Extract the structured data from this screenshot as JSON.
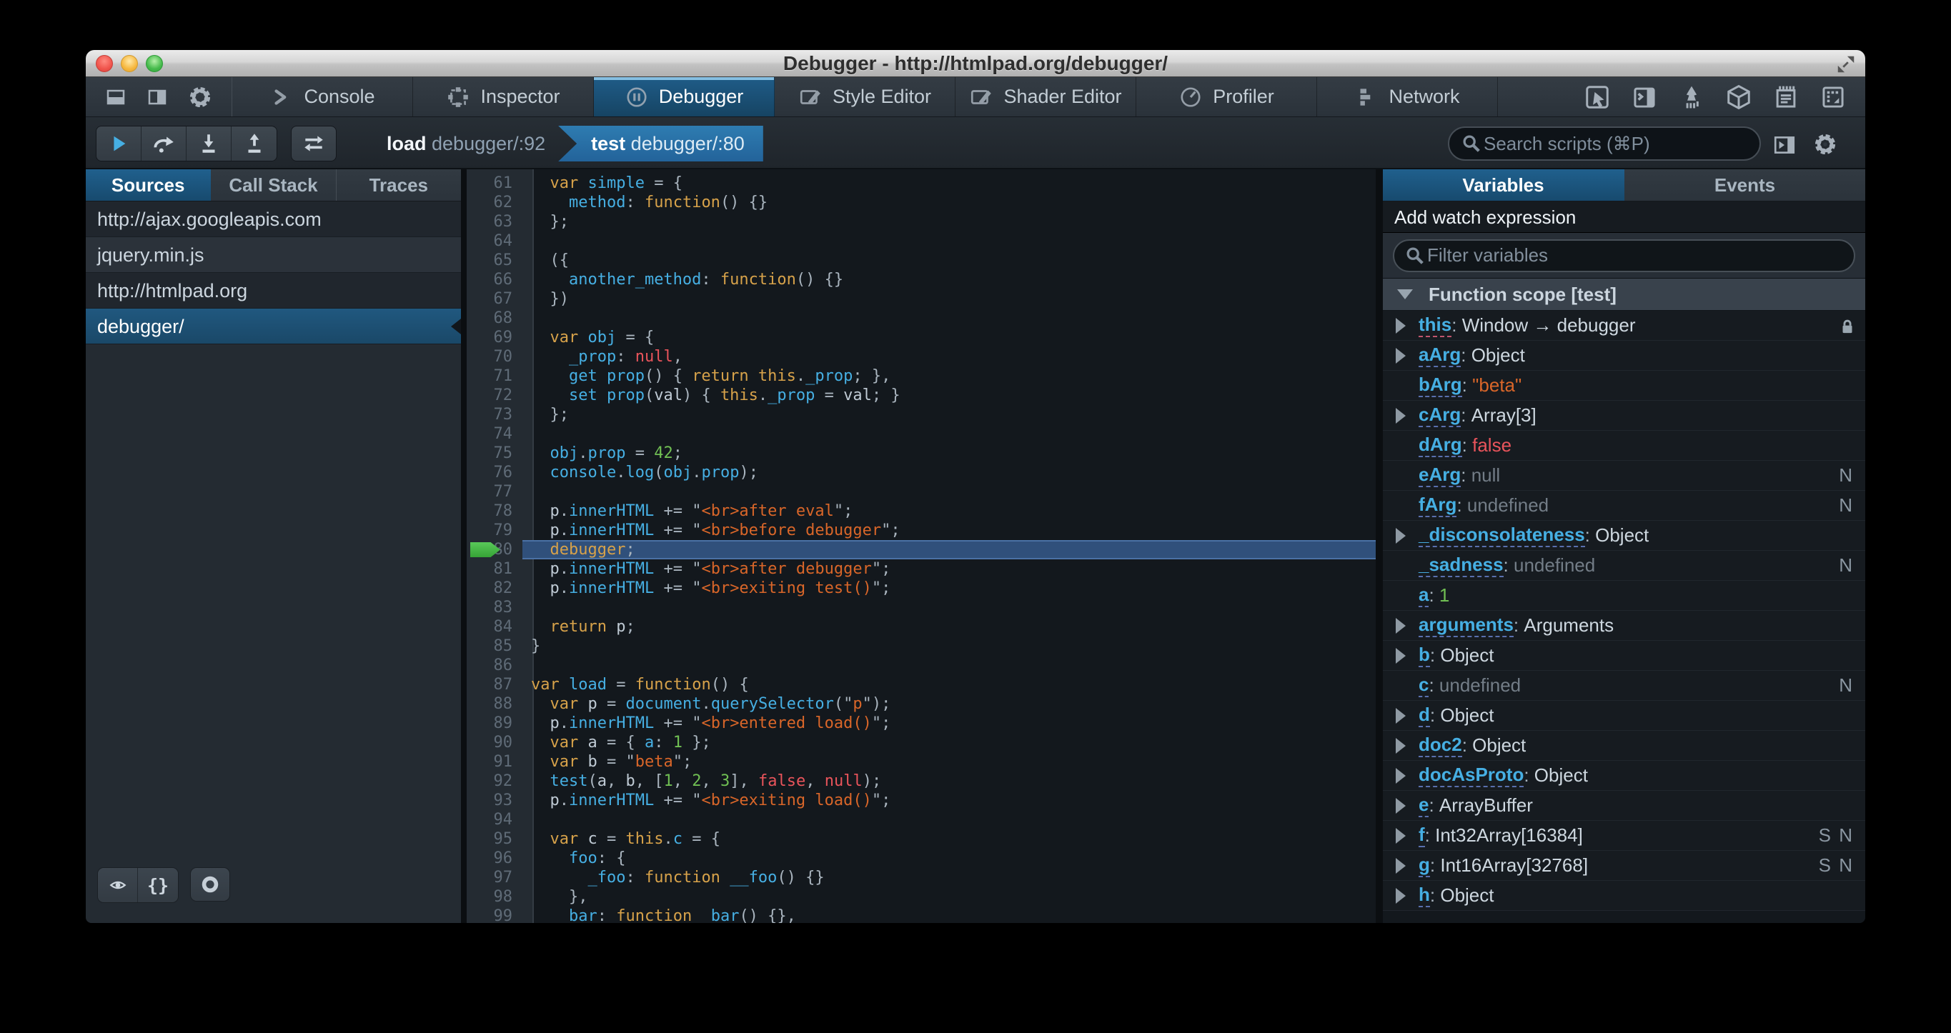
{
  "window": {
    "title": "Debugger - http://htmlpad.org/debugger/"
  },
  "colors": {
    "accent_blue": "#46afe3",
    "tab_active": "#1f5c88",
    "selection_blue": "#20587f",
    "breadcrumb_active": "#2a71a8",
    "current_line": "#30507b",
    "run_arrow_green": "#46bb46",
    "keyword": "#d7a24a",
    "string": "#d96629",
    "number": "#70bf53",
    "atom_red": "#e9545b",
    "toolbar_bg": "#2e363e",
    "editor_bg": "#13181d"
  },
  "toolbar": {
    "left_icons": [
      "dock-bottom",
      "dock-side",
      "settings-gear"
    ],
    "tabs": [
      {
        "label": "Console",
        "icon": "console"
      },
      {
        "label": "Inspector",
        "icon": "inspector"
      },
      {
        "label": "Debugger",
        "icon": "debugger"
      },
      {
        "label": "Style Editor",
        "icon": "style-editor"
      },
      {
        "label": "Shader Editor",
        "icon": "shader-editor"
      },
      {
        "label": "Profiler",
        "icon": "profiler"
      },
      {
        "label": "Network",
        "icon": "network"
      }
    ],
    "active_tab": "Debugger",
    "right_icons": [
      "pick-element",
      "split-console",
      "paintbrush",
      "tilt-3d",
      "scratchpad",
      "responsive-mode"
    ]
  },
  "debugger_toolbar": {
    "buttons": [
      "resume",
      "step-over",
      "step-in",
      "step-out"
    ],
    "toggle_button": "toggle-breakpoints",
    "breadcrumbs": [
      {
        "fn": "load",
        "loc": " debugger/:92",
        "active": false
      },
      {
        "fn": "test",
        "loc": " debugger/:80",
        "active": true
      }
    ],
    "search_placeholder": "Search scripts (⌘P)"
  },
  "sources_panel": {
    "tabs": [
      "Sources",
      "Call Stack",
      "Traces"
    ],
    "active_tab": "Sources",
    "items": [
      {
        "label": "http://ajax.googleapis.com",
        "type": "domain",
        "selected": false
      },
      {
        "label": "jquery.min.js",
        "type": "file",
        "selected": false
      },
      {
        "label": "http://htmlpad.org",
        "type": "domain",
        "selected": false
      },
      {
        "label": "debugger/",
        "type": "file",
        "selected": true
      }
    ],
    "bottom_buttons": [
      "blackbox-eye",
      "pretty-print",
      "pause-exceptions"
    ]
  },
  "editor": {
    "current_line": 80,
    "lines": [
      {
        "n": 61,
        "segs": [
          [
            "p",
            "  "
          ],
          [
            "k",
            "var"
          ],
          [
            "p",
            " "
          ],
          [
            "i",
            "simple"
          ],
          [
            "p",
            " = {"
          ]
        ]
      },
      {
        "n": 62,
        "segs": [
          [
            "p",
            "    "
          ],
          [
            "i",
            "method"
          ],
          [
            "p",
            ": "
          ],
          [
            "k",
            "function"
          ],
          [
            "p",
            "() {}"
          ]
        ]
      },
      {
        "n": 63,
        "segs": [
          [
            "p",
            "  };"
          ]
        ]
      },
      {
        "n": 64,
        "segs": []
      },
      {
        "n": 65,
        "segs": [
          [
            "p",
            "  ({"
          ]
        ]
      },
      {
        "n": 66,
        "segs": [
          [
            "p",
            "    "
          ],
          [
            "i",
            "another_method"
          ],
          [
            "p",
            ": "
          ],
          [
            "k",
            "function"
          ],
          [
            "p",
            "() {}"
          ]
        ]
      },
      {
        "n": 67,
        "segs": [
          [
            "p",
            "  })"
          ]
        ]
      },
      {
        "n": 68,
        "segs": []
      },
      {
        "n": 69,
        "segs": [
          [
            "p",
            "  "
          ],
          [
            "k",
            "var"
          ],
          [
            "p",
            " "
          ],
          [
            "i",
            "obj"
          ],
          [
            "p",
            " = {"
          ]
        ]
      },
      {
        "n": 70,
        "segs": [
          [
            "p",
            "    "
          ],
          [
            "i",
            "_prop"
          ],
          [
            "p",
            ": "
          ],
          [
            "a",
            "null"
          ],
          [
            "p",
            ","
          ]
        ]
      },
      {
        "n": 71,
        "segs": [
          [
            "p",
            "    "
          ],
          [
            "i",
            "get prop"
          ],
          [
            "p",
            "() { "
          ],
          [
            "k",
            "return"
          ],
          [
            "p",
            " "
          ],
          [
            "k",
            "this"
          ],
          [
            "p",
            "."
          ],
          [
            "i",
            "_prop"
          ],
          [
            "p",
            "; },"
          ]
        ]
      },
      {
        "n": 72,
        "segs": [
          [
            "p",
            "    "
          ],
          [
            "i",
            "set prop"
          ],
          [
            "p",
            "("
          ],
          [
            "v",
            "val"
          ],
          [
            "p",
            ") { "
          ],
          [
            "k",
            "this"
          ],
          [
            "p",
            "."
          ],
          [
            "i",
            "_prop"
          ],
          [
            "p",
            " = "
          ],
          [
            "v",
            "val"
          ],
          [
            "p",
            "; }"
          ]
        ]
      },
      {
        "n": 73,
        "segs": [
          [
            "p",
            "  };"
          ]
        ]
      },
      {
        "n": 74,
        "segs": []
      },
      {
        "n": 75,
        "segs": [
          [
            "p",
            "  "
          ],
          [
            "i",
            "obj"
          ],
          [
            "p",
            "."
          ],
          [
            "i",
            "prop"
          ],
          [
            "p",
            " = "
          ],
          [
            "n",
            "42"
          ],
          [
            "p",
            ";"
          ]
        ]
      },
      {
        "n": 76,
        "segs": [
          [
            "p",
            "  "
          ],
          [
            "i",
            "console"
          ],
          [
            "p",
            "."
          ],
          [
            "i",
            "log"
          ],
          [
            "p",
            "("
          ],
          [
            "i",
            "obj"
          ],
          [
            "p",
            "."
          ],
          [
            "i",
            "prop"
          ],
          [
            "p",
            ");"
          ]
        ]
      },
      {
        "n": 77,
        "segs": []
      },
      {
        "n": 78,
        "segs": [
          [
            "p",
            "  "
          ],
          [
            "v",
            "p"
          ],
          [
            "p",
            "."
          ],
          [
            "i",
            "innerHTML"
          ],
          [
            "p",
            " += \""
          ],
          [
            "s",
            "<br>after eval"
          ],
          [
            "p",
            "\";"
          ]
        ]
      },
      {
        "n": 79,
        "segs": [
          [
            "p",
            "  "
          ],
          [
            "v",
            "p"
          ],
          [
            "p",
            "."
          ],
          [
            "i",
            "innerHTML"
          ],
          [
            "p",
            " += \""
          ],
          [
            "s",
            "<br>before debugger"
          ],
          [
            "p",
            "\";"
          ]
        ]
      },
      {
        "n": 80,
        "segs": [
          [
            "p",
            "  "
          ],
          [
            "k",
            "debugger"
          ],
          [
            "p",
            ";"
          ]
        ]
      },
      {
        "n": 81,
        "segs": [
          [
            "p",
            "  "
          ],
          [
            "v",
            "p"
          ],
          [
            "p",
            "."
          ],
          [
            "i",
            "innerHTML"
          ],
          [
            "p",
            " += \""
          ],
          [
            "s",
            "<br>after debugger"
          ],
          [
            "p",
            "\";"
          ]
        ]
      },
      {
        "n": 82,
        "segs": [
          [
            "p",
            "  "
          ],
          [
            "v",
            "p"
          ],
          [
            "p",
            "."
          ],
          [
            "i",
            "innerHTML"
          ],
          [
            "p",
            " += \""
          ],
          [
            "s",
            "<br>exiting test()"
          ],
          [
            "p",
            "\";"
          ]
        ]
      },
      {
        "n": 83,
        "segs": []
      },
      {
        "n": 84,
        "segs": [
          [
            "p",
            "  "
          ],
          [
            "k",
            "return"
          ],
          [
            "p",
            " "
          ],
          [
            "v",
            "p"
          ],
          [
            "p",
            ";"
          ]
        ]
      },
      {
        "n": 85,
        "segs": [
          [
            "p",
            "}"
          ]
        ]
      },
      {
        "n": 86,
        "segs": []
      },
      {
        "n": 87,
        "segs": [
          [
            "k",
            "var"
          ],
          [
            "p",
            " "
          ],
          [
            "i",
            "load"
          ],
          [
            "p",
            " = "
          ],
          [
            "k",
            "function"
          ],
          [
            "p",
            "() {"
          ]
        ]
      },
      {
        "n": 88,
        "segs": [
          [
            "p",
            "  "
          ],
          [
            "k",
            "var"
          ],
          [
            "p",
            " "
          ],
          [
            "v",
            "p"
          ],
          [
            "p",
            " = "
          ],
          [
            "i",
            "document"
          ],
          [
            "p",
            "."
          ],
          [
            "i",
            "querySelector"
          ],
          [
            "p",
            "(\""
          ],
          [
            "s",
            "p"
          ],
          [
            "p",
            "\");"
          ]
        ]
      },
      {
        "n": 89,
        "segs": [
          [
            "p",
            "  "
          ],
          [
            "v",
            "p"
          ],
          [
            "p",
            "."
          ],
          [
            "i",
            "innerHTML"
          ],
          [
            "p",
            " += \""
          ],
          [
            "s",
            "<br>entered load()"
          ],
          [
            "p",
            "\";"
          ]
        ]
      },
      {
        "n": 90,
        "segs": [
          [
            "p",
            "  "
          ],
          [
            "k",
            "var"
          ],
          [
            "p",
            " "
          ],
          [
            "v",
            "a"
          ],
          [
            "p",
            " = { "
          ],
          [
            "i",
            "a"
          ],
          [
            "p",
            ": "
          ],
          [
            "n",
            "1"
          ],
          [
            "p",
            " };"
          ]
        ]
      },
      {
        "n": 91,
        "segs": [
          [
            "p",
            "  "
          ],
          [
            "k",
            "var"
          ],
          [
            "p",
            " "
          ],
          [
            "v",
            "b"
          ],
          [
            "p",
            " = \""
          ],
          [
            "s",
            "beta"
          ],
          [
            "p",
            "\";"
          ]
        ]
      },
      {
        "n": 92,
        "segs": [
          [
            "p",
            "  "
          ],
          [
            "i",
            "test"
          ],
          [
            "p",
            "("
          ],
          [
            "v",
            "a"
          ],
          [
            "p",
            ", "
          ],
          [
            "v",
            "b"
          ],
          [
            "p",
            ", ["
          ],
          [
            "n",
            "1"
          ],
          [
            "p",
            ", "
          ],
          [
            "n",
            "2"
          ],
          [
            "p",
            ", "
          ],
          [
            "n",
            "3"
          ],
          [
            "p",
            "], "
          ],
          [
            "a",
            "false"
          ],
          [
            "p",
            ", "
          ],
          [
            "a",
            "null"
          ],
          [
            "p",
            ");"
          ]
        ]
      },
      {
        "n": 93,
        "segs": [
          [
            "p",
            "  "
          ],
          [
            "v",
            "p"
          ],
          [
            "p",
            "."
          ],
          [
            "i",
            "innerHTML"
          ],
          [
            "p",
            " += \""
          ],
          [
            "s",
            "<br>exiting load()"
          ],
          [
            "p",
            "\";"
          ]
        ]
      },
      {
        "n": 94,
        "segs": []
      },
      {
        "n": 95,
        "segs": [
          [
            "p",
            "  "
          ],
          [
            "k",
            "var"
          ],
          [
            "p",
            " "
          ],
          [
            "v",
            "c"
          ],
          [
            "p",
            " = "
          ],
          [
            "k",
            "this"
          ],
          [
            "p",
            "."
          ],
          [
            "i",
            "c"
          ],
          [
            "p",
            " = {"
          ]
        ]
      },
      {
        "n": 96,
        "segs": [
          [
            "p",
            "    "
          ],
          [
            "i",
            "foo"
          ],
          [
            "p",
            ": {"
          ]
        ]
      },
      {
        "n": 97,
        "segs": [
          [
            "p",
            "      "
          ],
          [
            "i",
            "_foo"
          ],
          [
            "p",
            ": "
          ],
          [
            "k",
            "function"
          ],
          [
            "p",
            " "
          ],
          [
            "i",
            "__foo"
          ],
          [
            "p",
            "() {}"
          ]
        ]
      },
      {
        "n": 98,
        "segs": [
          [
            "p",
            "    },"
          ]
        ]
      },
      {
        "n": 99,
        "segs": [
          [
            "p",
            "    "
          ],
          [
            "i",
            "bar"
          ],
          [
            "p",
            ": "
          ],
          [
            "k",
            "function"
          ],
          [
            "p",
            " "
          ],
          [
            "i",
            "_bar"
          ],
          [
            "p",
            "() {},"
          ]
        ]
      }
    ]
  },
  "variables_panel": {
    "tabs": [
      "Variables",
      "Events"
    ],
    "active_tab": "Variables",
    "watch_label": "Add watch expression",
    "filter_placeholder": "Filter variables",
    "scope_label": "Function scope [test]",
    "rows": [
      {
        "name": "this",
        "value": "Window → debugger",
        "vc": "obj",
        "exp": true,
        "lock": true,
        "pink": true,
        "badges": []
      },
      {
        "name": "aArg",
        "value": "Object",
        "vc": "obj",
        "exp": true,
        "badges": []
      },
      {
        "name": "bArg",
        "value": "\"beta\"",
        "vc": "str",
        "exp": false,
        "badges": []
      },
      {
        "name": "cArg",
        "value": "Array[3]",
        "vc": "obj",
        "exp": true,
        "badges": []
      },
      {
        "name": "dArg",
        "value": "false",
        "vc": "atom",
        "exp": false,
        "badges": []
      },
      {
        "name": "eArg",
        "value": "null",
        "vc": "dim",
        "exp": false,
        "badges": [
          "N"
        ]
      },
      {
        "name": "fArg",
        "value": "undefined",
        "vc": "dim",
        "exp": false,
        "badges": [
          "N"
        ]
      },
      {
        "name": "_disconsolateness",
        "value": "Object",
        "vc": "obj",
        "exp": true,
        "badges": []
      },
      {
        "name": "_sadness",
        "value": "undefined",
        "vc": "dim",
        "exp": false,
        "badges": [
          "N"
        ]
      },
      {
        "name": "a",
        "value": "1",
        "vc": "num",
        "exp": false,
        "badges": []
      },
      {
        "name": "arguments",
        "value": "Arguments",
        "vc": "obj",
        "exp": true,
        "badges": []
      },
      {
        "name": "b",
        "value": "Object",
        "vc": "obj",
        "exp": true,
        "badges": []
      },
      {
        "name": "c",
        "value": "undefined",
        "vc": "dim",
        "exp": false,
        "badges": [
          "N"
        ]
      },
      {
        "name": "d",
        "value": "Object",
        "vc": "obj",
        "exp": true,
        "badges": []
      },
      {
        "name": "doc2",
        "value": "Object",
        "vc": "obj",
        "exp": true,
        "badges": []
      },
      {
        "name": "docAsProto",
        "value": "Object",
        "vc": "obj",
        "exp": true,
        "badges": []
      },
      {
        "name": "e",
        "value": "ArrayBuffer",
        "vc": "obj",
        "exp": true,
        "badges": []
      },
      {
        "name": "f",
        "value": "Int32Array[16384]",
        "vc": "obj",
        "exp": true,
        "badges": [
          "S",
          "N"
        ]
      },
      {
        "name": "g",
        "value": "Int16Array[32768]",
        "vc": "obj",
        "exp": true,
        "badges": [
          "S",
          "N"
        ]
      },
      {
        "name": "h",
        "value": "Object",
        "vc": "obj",
        "exp": true,
        "badges": []
      }
    ]
  }
}
